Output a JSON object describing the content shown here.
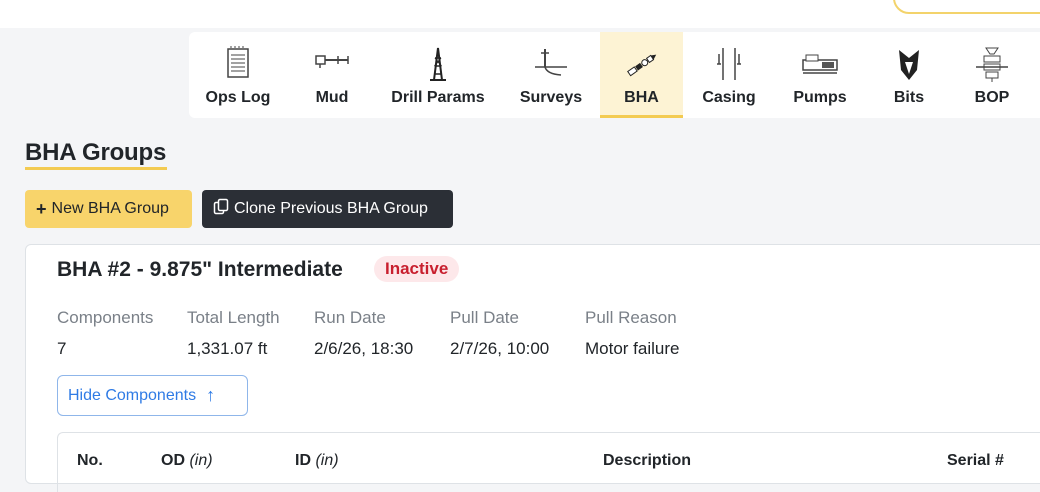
{
  "tabs": [
    {
      "label": "Ops Log",
      "icon": "ops-log-icon"
    },
    {
      "label": "Mud",
      "icon": "mud-icon"
    },
    {
      "label": "Drill Params",
      "icon": "drill-rig-icon"
    },
    {
      "label": "Surveys",
      "icon": "surveys-icon"
    },
    {
      "label": "BHA",
      "icon": "bha-icon",
      "active": true
    },
    {
      "label": "Casing",
      "icon": "casing-icon"
    },
    {
      "label": "Pumps",
      "icon": "pumps-icon"
    },
    {
      "label": "Bits",
      "icon": "bits-icon"
    },
    {
      "label": "BOP",
      "icon": "bop-icon"
    }
  ],
  "section": {
    "title": "BHA Groups"
  },
  "actions": {
    "new_label": "New BHA Group",
    "clone_label": "Clone Previous BHA Group"
  },
  "bha": {
    "title": "BHA #2 - 9.875\" Intermediate",
    "status": "Inactive",
    "status_color": "#c81f2e",
    "stats": [
      {
        "label": "Components",
        "value": "7"
      },
      {
        "label": "Total Length",
        "value": "1,331.07 ft"
      },
      {
        "label": "Run Date",
        "value": "2/6/26, 18:30"
      },
      {
        "label": "Pull Date",
        "value": "2/7/26, 10:00"
      },
      {
        "label": "Pull Reason",
        "value": "Motor failure"
      }
    ],
    "toggle_label": "Hide Components",
    "columns": [
      {
        "label": "No.",
        "unit": ""
      },
      {
        "label": "OD",
        "unit": "(in)"
      },
      {
        "label": "ID",
        "unit": "(in)"
      },
      {
        "label": "Description",
        "unit": ""
      },
      {
        "label": "Serial #",
        "unit": ""
      }
    ]
  },
  "colors": {
    "accent": "#f3cb52",
    "link": "#2f7be5",
    "dark_button": "#2b2f36"
  }
}
